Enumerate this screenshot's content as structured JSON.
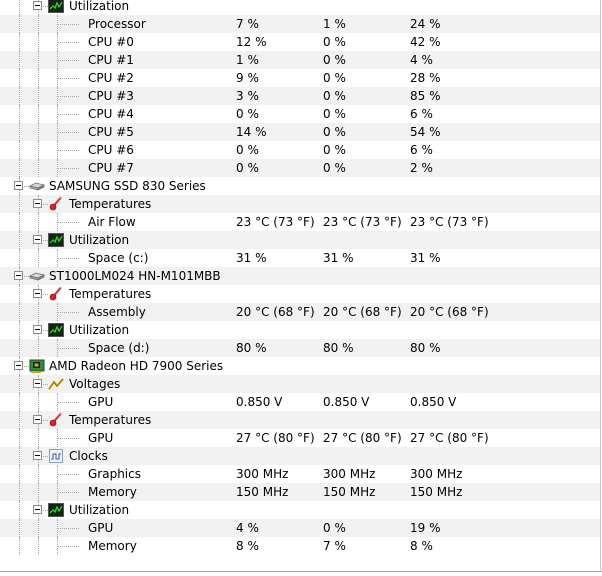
{
  "tree": [
    {
      "kind": "group",
      "label": "Utilization",
      "icon": "utilization-icon",
      "level": 1
    },
    {
      "kind": "data",
      "label": "Processor",
      "v1": "7 %",
      "v2": "1 %",
      "v3": "24 %"
    },
    {
      "kind": "data",
      "label": "CPU #0",
      "v1": "12 %",
      "v2": "0 %",
      "v3": "42 %"
    },
    {
      "kind": "data",
      "label": "CPU #1",
      "v1": "1 %",
      "v2": "0 %",
      "v3": "4 %"
    },
    {
      "kind": "data",
      "label": "CPU #2",
      "v1": "9 %",
      "v2": "0 %",
      "v3": "28 %"
    },
    {
      "kind": "data",
      "label": "CPU #3",
      "v1": "3 %",
      "v2": "0 %",
      "v3": "85 %"
    },
    {
      "kind": "data",
      "label": "CPU #4",
      "v1": "0 %",
      "v2": "0 %",
      "v3": "6 %"
    },
    {
      "kind": "data",
      "label": "CPU #5",
      "v1": "14 %",
      "v2": "0 %",
      "v3": "54 %"
    },
    {
      "kind": "data",
      "label": "CPU #6",
      "v1": "0 %",
      "v2": "0 %",
      "v3": "6 %"
    },
    {
      "kind": "data",
      "label": "CPU #7",
      "v1": "0 %",
      "v2": "0 %",
      "v3": "2 %"
    },
    {
      "kind": "device",
      "label": "SAMSUNG SSD 830 Series",
      "icon": "disk-drive-icon"
    },
    {
      "kind": "group",
      "label": "Temperatures",
      "icon": "thermometer-icon",
      "level": 1
    },
    {
      "kind": "data",
      "label": "Air Flow",
      "v1": "23 °C  (73 °F)",
      "v2": "23 °C  (73 °F)",
      "v3": "23 °C  (73 °F)"
    },
    {
      "kind": "group",
      "label": "Utilization",
      "icon": "utilization-icon",
      "level": 1
    },
    {
      "kind": "data",
      "label": "Space (c:)",
      "v1": "31 %",
      "v2": "31 %",
      "v3": "31 %"
    },
    {
      "kind": "device",
      "label": "ST1000LM024 HN-M101MBB",
      "icon": "disk-drive-icon"
    },
    {
      "kind": "group",
      "label": "Temperatures",
      "icon": "thermometer-icon",
      "level": 1
    },
    {
      "kind": "data",
      "label": "Assembly",
      "v1": "20 °C  (68 °F)",
      "v2": "20 °C  (68 °F)",
      "v3": "20 °C  (68 °F)"
    },
    {
      "kind": "group",
      "label": "Utilization",
      "icon": "utilization-icon",
      "level": 1
    },
    {
      "kind": "data",
      "label": "Space (d:)",
      "v1": "80 %",
      "v2": "80 %",
      "v3": "80 %"
    },
    {
      "kind": "device",
      "label": "AMD Radeon HD 7900 Series",
      "icon": "graphics-card-icon"
    },
    {
      "kind": "group",
      "label": "Voltages",
      "icon": "voltage-icon",
      "level": 1
    },
    {
      "kind": "data",
      "label": "GPU",
      "v1": "0.850 V",
      "v2": "0.850 V",
      "v3": "0.850 V"
    },
    {
      "kind": "group",
      "label": "Temperatures",
      "icon": "thermometer-icon",
      "level": 1
    },
    {
      "kind": "data",
      "label": "GPU",
      "v1": "27 °C  (80 °F)",
      "v2": "27 °C  (80 °F)",
      "v3": "27 °C  (80 °F)"
    },
    {
      "kind": "group",
      "label": "Clocks",
      "icon": "clock-icon",
      "level": 1
    },
    {
      "kind": "data",
      "label": "Graphics",
      "v1": "300 MHz",
      "v2": "300 MHz",
      "v3": "300 MHz"
    },
    {
      "kind": "data",
      "label": "Memory",
      "v1": "150 MHz",
      "v2": "150 MHz",
      "v3": "150 MHz"
    },
    {
      "kind": "group",
      "label": "Utilization",
      "icon": "utilization-icon",
      "level": 1
    },
    {
      "kind": "data",
      "label": "GPU",
      "v1": "4 %",
      "v2": "0 %",
      "v3": "19 %"
    },
    {
      "kind": "data",
      "label": "Memory",
      "v1": "8 %",
      "v2": "7 %",
      "v3": "8 %"
    }
  ]
}
